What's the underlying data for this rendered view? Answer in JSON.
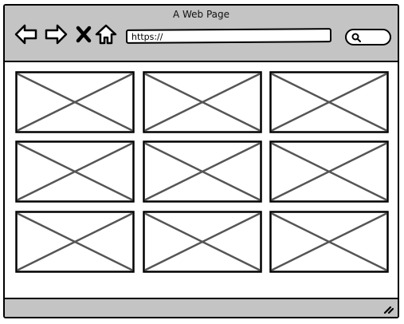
{
  "window": {
    "title": "A Web Page"
  },
  "toolbar": {
    "back_icon": "left-arrow-icon",
    "forward_icon": "right-arrow-icon",
    "stop_icon": "close-x-icon",
    "home_icon": "home-icon",
    "url": "https://",
    "search_icon": "magnifier-icon"
  },
  "content": {
    "image_placeholders": [
      {
        "row": 1,
        "col": 1
      },
      {
        "row": 1,
        "col": 2
      },
      {
        "row": 1,
        "col": 3
      },
      {
        "row": 2,
        "col": 1
      },
      {
        "row": 2,
        "col": 2
      },
      {
        "row": 2,
        "col": 3
      },
      {
        "row": 3,
        "col": 1
      },
      {
        "row": 3,
        "col": 2
      },
      {
        "row": 3,
        "col": 3
      }
    ]
  },
  "colors": {
    "chrome": "#c4c4c4",
    "stroke": "#000000",
    "placeholder_stroke": "#555555"
  }
}
